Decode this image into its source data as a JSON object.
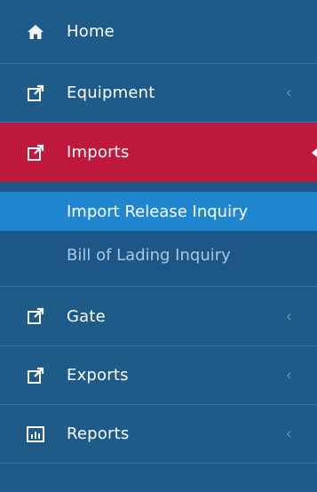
{
  "menu": {
    "home": {
      "label": "Home",
      "icon": "home-icon"
    },
    "equipment": {
      "label": "Equipment",
      "icon": "external-link-icon",
      "chevron": "‹"
    },
    "imports": {
      "label": "Imports",
      "icon": "external-link-icon",
      "submenu": [
        {
          "label": "Import Release Inquiry",
          "selected": true
        },
        {
          "label": "Bill of Lading Inquiry",
          "selected": false
        }
      ]
    },
    "gate": {
      "label": "Gate",
      "icon": "external-link-icon",
      "chevron": "‹"
    },
    "exports": {
      "label": "Exports",
      "icon": "external-link-icon",
      "chevron": "‹"
    },
    "reports": {
      "label": "Reports",
      "icon": "bar-chart-icon",
      "chevron": "‹"
    }
  },
  "colors": {
    "sidebar_bg": "#1f5b88",
    "active_bg": "#bf1a3d",
    "selected_sub_bg": "#1f86cf",
    "muted_text": "#a9c8e2"
  }
}
